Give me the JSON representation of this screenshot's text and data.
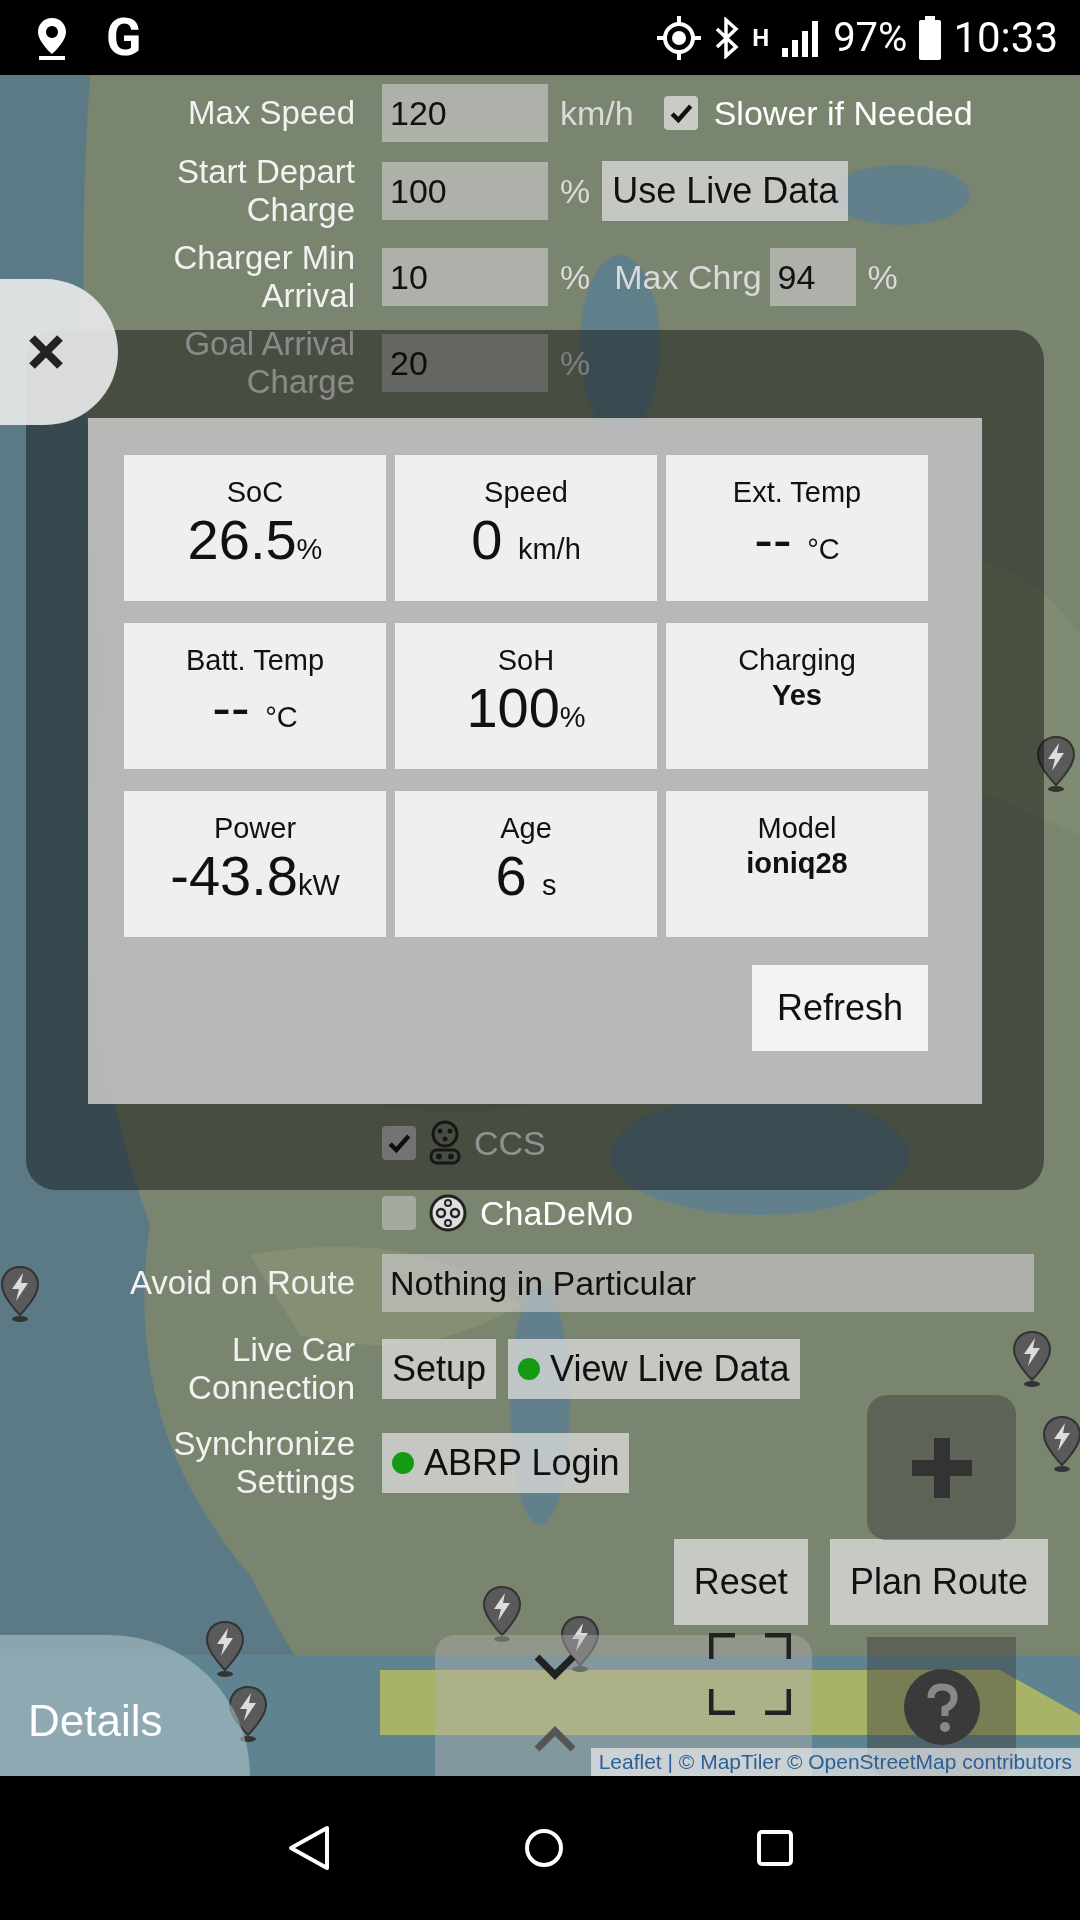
{
  "status_bar": {
    "app_badge": "G",
    "network": "H",
    "battery": "97%",
    "time": "10:33"
  },
  "form": {
    "max_speed": {
      "label": "Max Speed",
      "value": "120",
      "unit": "km/h",
      "option": {
        "label": "Slower if Needed",
        "checked": true
      }
    },
    "start_depart": {
      "label": "Start Depart Charge",
      "value": "100",
      "unit": "%",
      "button": "Use Live Data"
    },
    "charger_min": {
      "label": "Charger Min Arrival",
      "value": "10",
      "unit": "%",
      "extra_label": "Max Chrg",
      "extra_value": "94",
      "extra_unit": "%"
    },
    "goal_arrival": {
      "label": "Goal Arrival Charge",
      "value": "20",
      "unit": "%"
    },
    "connectors": [
      {
        "label": "CCS",
        "checked": true,
        "kind": "ccs"
      },
      {
        "label": "ChaDeMo",
        "checked": false,
        "kind": "chademo"
      }
    ],
    "avoid": {
      "label": "Avoid on Route",
      "value": "Nothing in Particular"
    },
    "live_car": {
      "label": "Live Car Connection",
      "buttons": [
        {
          "label": "Setup"
        },
        {
          "label": "View Live Data",
          "color": "#159a15"
        }
      ]
    },
    "sync": {
      "label": "Synchronize Settings",
      "button": {
        "label": "ABRP Login",
        "color": "#159a15"
      }
    },
    "actions": [
      "Reset",
      "Plan Route"
    ]
  },
  "map": {
    "details": "Details",
    "attribution": "Leaflet | © MapTiler © OpenStreetMap contributors"
  },
  "live_data": {
    "tiles": [
      {
        "label": "SoC",
        "value": "26.5",
        "unit": "%",
        "kind": "reading"
      },
      {
        "label": "Speed",
        "value": "0",
        "unit": "km/h",
        "kind": "reading"
      },
      {
        "label": "Ext. Temp",
        "value": "--",
        "unit": "°C",
        "kind": "reading"
      },
      {
        "label": "Batt. Temp",
        "value": "--",
        "unit": "°C",
        "kind": "reading"
      },
      {
        "label": "SoH",
        "value": "100",
        "unit": "%",
        "kind": "reading"
      },
      {
        "label": "Charging",
        "value": "Yes",
        "kind": "text"
      },
      {
        "label": "Power",
        "value": "-43.8",
        "unit": "kW",
        "kind": "reading"
      },
      {
        "label": "Age",
        "value": "6",
        "unit": "s",
        "kind": "reading"
      },
      {
        "label": "Model",
        "value": "ioniq28",
        "kind": "text"
      }
    ],
    "refresh": "Refresh"
  }
}
